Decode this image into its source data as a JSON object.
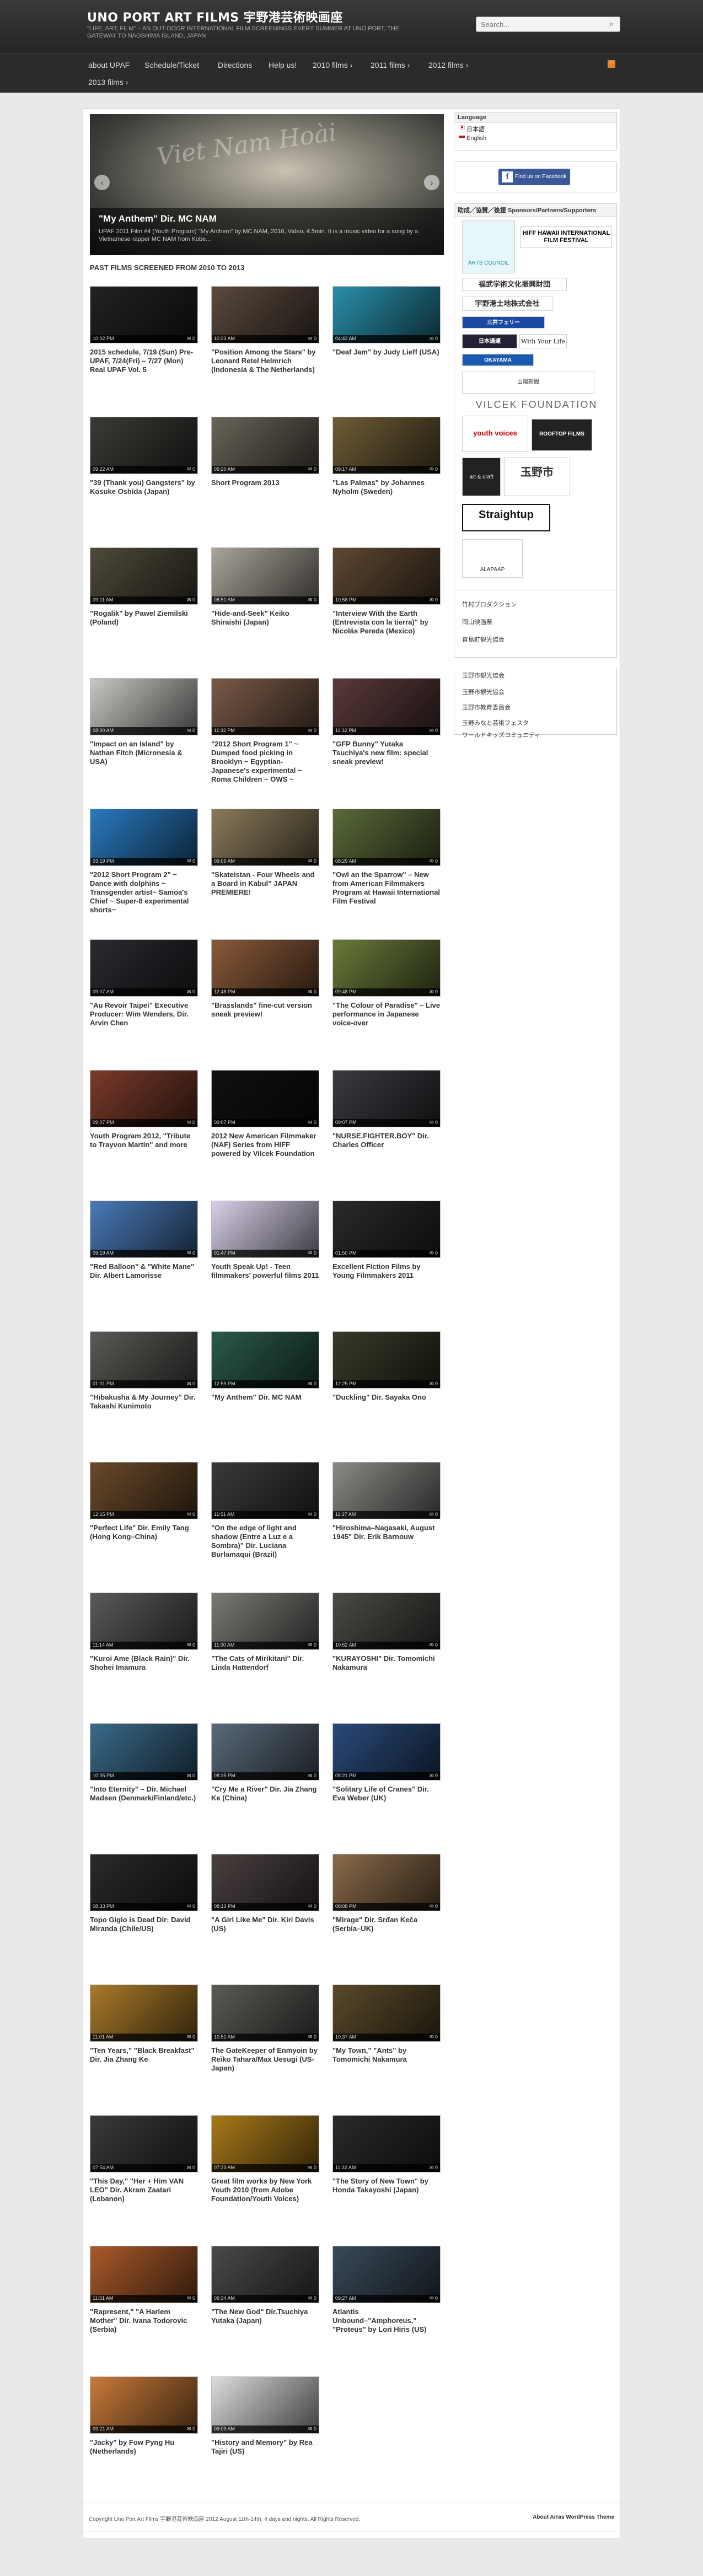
{
  "site": {
    "title": "UNO PORT ART FILMS 宇野港芸術映画座",
    "tagline": "\"LIFE, ART, FILM\" – AN OUT-DOOR INTERNATIONAL FILM SCREENINGS EVERY SUMMER AT UNO PORT, THE GATEWAY TO NAOSHIMA ISLAND, JAPAN",
    "search_placeholder": "Search..."
  },
  "nav": {
    "items": [
      "about UPAF",
      "Schedule/Ticket",
      "Directions",
      "Help us!",
      "2010 films ›",
      "2011 films ›",
      "2012 films ›"
    ],
    "row2": [
      "2013 films ›"
    ],
    "rss": "RSS"
  },
  "slider": {
    "title": "\"My Anthem\" Dir. MC NAM",
    "desc": "UPAF 2011 Film #4 (Youth Program) \"My Anthem\" by MC NAM, 2010, Video, 4.5min. It is a music video for a song by a Vietnamese rapper MC NAM from Kobe...",
    "graffiti": "Viet Nam Hoài",
    "prev": "‹",
    "next": "›"
  },
  "section_heading": "PAST FILMS SCREENED FROM 2010 TO 2013",
  "posts": [
    {
      "title": "2015 schedule, 7/19 (Sun) Pre-UPAF, 7/24(Fri) – 7/27 (Mon) Real UPAF Vol. 5",
      "time": "10:02 PM",
      "comments": "0",
      "color": "#222"
    },
    {
      "title": "\"Position Among the Stars\" by Leonard Retel Helmrich (Indonesia & The Netherlands)",
      "time": "10:23 AM",
      "comments": "0",
      "color": "#5a4a3e"
    },
    {
      "title": "\"Deaf Jam\" by Judy Lieff (USA)",
      "time": "04:42 AM",
      "comments": "0",
      "color": "#2a8faa"
    },
    {
      "title": "\"39 (Thank you) Gangsters\" by Kosuke Oshida (Japan)",
      "time": "09:22 AM",
      "comments": "0",
      "color": "#3a3a36"
    },
    {
      "title": "Short Program 2013",
      "time": "09:20 AM",
      "comments": "0",
      "color": "#6a6458"
    },
    {
      "title": "\"Las Palmas\" by Johannes Nyholm (Sweden)",
      "time": "09:17 AM",
      "comments": "0",
      "color": "#6e5c36"
    },
    {
      "title": "\"Rogalik\" by Pawel Ziemilski (Poland)",
      "time": "09:11 AM",
      "comments": "0",
      "color": "#4e4a3a"
    },
    {
      "title": "\"Hide-and-Seek\" Keiko Shiraishi (Japan)",
      "time": "08:51 AM",
      "comments": "0",
      "color": "#aaa49a"
    },
    {
      "title": "\"Interview With the Earth (Entrevista con la tierra)\" by Nicolás Pereda (Mexico)",
      "time": "10:58 PM",
      "comments": "0",
      "color": "#5e4832"
    },
    {
      "title": "\"Impact on an Island\" by Nathan Fitch (Micronesia & USA)",
      "time": "08:00 AM",
      "comments": "0",
      "color": "#c8c8c4"
    },
    {
      "title": "\"2012 Short Program 1\" ~ Dumped food picking in Brooklyn ~ Egyptian-Japanese's experimental ~ Roma Children ~ OWS ~",
      "time": "11:32 PM",
      "comments": "0",
      "color": "#7a5a48"
    },
    {
      "title": "\"GFP Bunny\" Yutaka Tsuchiya's new film: special sneak preview!",
      "time": "11:32 PM",
      "comments": "0",
      "color": "#5a3a3a"
    },
    {
      "title": "\"2012 Short Program 2\" ~ Dance with dolphins ~ Transgender artist~ Samoa's Chief ~ Super-8 experimental shorts~",
      "time": "03:19 PM",
      "comments": "0",
      "color": "#2a7abf"
    },
    {
      "title": "\"Skateistan - Four Wheels and a Board in Kabul\" JAPAN PREMIERE!",
      "time": "09:06 AM",
      "comments": "0",
      "color": "#8a7a5a"
    },
    {
      "title": "\"Owl an the Sparrow\" – New from American Filmmakers Program at Hawaii International Film Festival",
      "time": "08:29 AM",
      "comments": "0",
      "color": "#5a6a3a"
    },
    {
      "title": "\"Au Revoir Taipei\" Executive Producer: Wim Wenders, Dir. Arvin Chen",
      "time": "09:07 AM",
      "comments": "0",
      "color": "#2a2a30"
    },
    {
      "title": "\"Brasslands\" fine-cut version sneak preview!",
      "time": "12:48 PM",
      "comments": "0",
      "color": "#8a5a3a"
    },
    {
      "title": "\"The Colour of Paradise\" – Live performance in Japanese voice-over",
      "time": "09:48 PM",
      "comments": "0",
      "color": "#6a7a3a"
    },
    {
      "title": "Youth Program 2012, \"Tribute to Trayvon Martin\" and more",
      "time": "09:07 PM",
      "comments": "0",
      "color": "#7a3a2a"
    },
    {
      "title": "2012 New American Filmmaker (NAF) Series from HIFF powered by Vilcek Foundation",
      "time": "09:07 PM",
      "comments": "0",
      "color": "#111"
    },
    {
      "title": "\"NURSE.FIGHTER.BOY\" Dir. Charles Officer",
      "time": "09:07 PM",
      "comments": "0",
      "color": "#3a3a40"
    },
    {
      "title": "\"Red Balloon\" & \"White Mane\" Dir. Albert Lamorisse",
      "time": "09:19 AM",
      "comments": "0",
      "color": "#4a7ab8"
    },
    {
      "title": "Youth Speak Up! - Teen filmmakers' powerful films 2011",
      "time": "01:47 PM",
      "comments": "0",
      "color": "#d8d0e8"
    },
    {
      "title": "Excellent Fiction Films by Young Filmmakers 2011",
      "time": "01:50 PM",
      "comments": "0",
      "color": "#2a2a2a"
    },
    {
      "title": "\"Hibakusha & My Journey\" Dir. Takashi Kunimoto",
      "time": "01:01 PM",
      "comments": "0",
      "color": "#5a5a56"
    },
    {
      "title": "\"My Anthem\" Dir. MC NAM",
      "time": "12:59 PM",
      "comments": "0",
      "color": "#2a5a4a"
    },
    {
      "title": "\"Duckling\" Dir. Sayaka Ono",
      "time": "12:25 PM",
      "comments": "0",
      "color": "#3a3a2a"
    },
    {
      "title": "\"Perfect Life\" Dir. Emily Tang (Hong Kong–China)",
      "time": "12:15 PM",
      "comments": "0",
      "color": "#6a4a2a"
    },
    {
      "title": "\"On the edge of light and shadow (Entre a Luz e a Sombra)\" Dir. Luciana Burlamaqui (Brazil)",
      "time": "11:51 AM",
      "comments": "0",
      "color": "#3a3a3a"
    },
    {
      "title": "\"Hiroshima–Nagasaki, August 1945\" Dir. Erik Barnouw",
      "time": "11:27 AM",
      "comments": "0",
      "color": "#8a8a86"
    },
    {
      "title": "\"Kuroi Ame (Black Rain)\" Dir. Shohei Imamura",
      "time": "11:14 AM",
      "comments": "0",
      "color": "#5a5a5a"
    },
    {
      "title": "\"The Cats of Mirikitani\" Dir. Linda Hattendorf",
      "time": "11:00 AM",
      "comments": "0",
      "color": "#7a7a76"
    },
    {
      "title": "\"KURAYOSHI\" Dir. Tomomichi Nakamura",
      "time": "10:52 AM",
      "comments": "0",
      "color": "#4a4a46"
    },
    {
      "title": "\"Into Eternity\" – Dir. Michael Madsen (Denmark/Finland/etc.)",
      "time": "10:05 PM",
      "comments": "0",
      "color": "#3a6a8a"
    },
    {
      "title": "\"Cry Me a River\" Dir. Jia Zhang Ke (China)",
      "time": "08:35 PM",
      "comments": "0",
      "color": "#5a6a7a"
    },
    {
      "title": "\"Solitary Life of Cranes\" Dir. Eva Weber (UK)",
      "time": "08:21 PM",
      "comments": "0",
      "color": "#2a4a7a"
    },
    {
      "title": "Topo Gigio is Dead Dir: David Miranda (Chile/US)",
      "time": "08:33 PM",
      "comments": "0",
      "color": "#2a2a2a"
    },
    {
      "title": "\"A Girl Like Me\" Dir. Kiri Davis (US)",
      "time": "08:13 PM",
      "comments": "0",
      "color": "#4a4040"
    },
    {
      "title": "\"Mirage\" Dir. Srđan Keča (Serbia–UK)",
      "time": "08:08 PM",
      "comments": "0",
      "color": "#8a6a4a"
    },
    {
      "title": "\"Ten Years,\" \"Black Breakfast\" Dir. Jia Zhang Ke",
      "time": "11:01 AM",
      "comments": "0",
      "color": "#aa7a2a"
    },
    {
      "title": "The GateKeeper of Enmyoin by Reiko Tahara/Max Uesugi (US-Japan)",
      "time": "10:51 AM",
      "comments": "0",
      "color": "#5a5a56"
    },
    {
      "title": "\"My Town,\" \"Ants\" by Tomomichi Nakamura",
      "time": "10:37 AM",
      "comments": "0",
      "color": "#5a4a2a"
    },
    {
      "title": "\"This Day,\" \"Her + Him VAN LEO\" Dir. Akram Zaatari (Lebanon)",
      "time": "07:54 AM",
      "comments": "0",
      "color": "#3a3a3a"
    },
    {
      "title": "Great film works by New York Youth 2010 (from Adobe Foundation/Youth Voices)",
      "time": "07:23 AM",
      "comments": "0",
      "color": "#aa7a1a"
    },
    {
      "title": "\"The Story of New Town\" by Honda Takayoshi (Japan)",
      "time": "11:32 AM",
      "comments": "0",
      "color": "#2a2a2a"
    },
    {
      "title": "\"Rapresent,\" \"A Harlem Mother\" Dir. Ivana Todorovic (Serbia)",
      "time": "11:31 AM",
      "comments": "0",
      "color": "#aa5a2a"
    },
    {
      "title": "\"The New God\" Dir.Tsuchiya Yutaka (Japan)",
      "time": "09:34 AM",
      "comments": "0",
      "color": "#4a4a4a"
    },
    {
      "title": "Atlantis Unbound–\"Amphoreus,\" \"Proteus\" by Lori Hiris (US)",
      "time": "09:27 AM",
      "comments": "0",
      "color": "#3a4a5a"
    },
    {
      "title": "\"Jacky\" by Fow Pyng Hu (Netherlands)",
      "time": "09:21 AM",
      "comments": "0",
      "color": "#c87a3a"
    },
    {
      "title": "\"History and Memory\" by Rea Tajiri (US)",
      "time": "09:09 AM",
      "comments": "0",
      "color": "#ddd"
    }
  ],
  "sidebar": {
    "language_title": "Language",
    "languages": [
      "日本語",
      "English"
    ],
    "facebook": "Find us on Facebook",
    "sponsors_title": "助成／協賛／後援 Sponsors/Partners/Supporters",
    "sponsors": [
      "ARTS COUNCIL",
      "HIFF HAWAII INTERNATIONAL FILM FESTIVAL",
      "福武学術文化振興財団",
      "宇野港土地株式会社",
      "三井フェリー",
      "日本通運",
      "With Your Life",
      "OKAYAMA",
      "山陽新聞",
      "VILCEK FOUNDATION",
      "youth voices",
      "ROOFTOP FILMS",
      "art & craft",
      "玉野市",
      "Straightup",
      "ALAPAAP"
    ],
    "links": [
      "竹村プロダクション",
      "岡山映画祭",
      "直島町観光協会",
      "玉野市観光協会",
      "玉野市観光協会",
      "玉野市教育委員会",
      "玉野みなと芸術フェスタ",
      "ワールドキッズコミュニティ"
    ]
  },
  "footer": {
    "copyright": "Copyright Uno Port Art Films 宇野港芸術映画座 2012 August 11th-14th, 4 days and nights. All Rights Reserved.",
    "theme": "About Arras WordPress Theme"
  }
}
